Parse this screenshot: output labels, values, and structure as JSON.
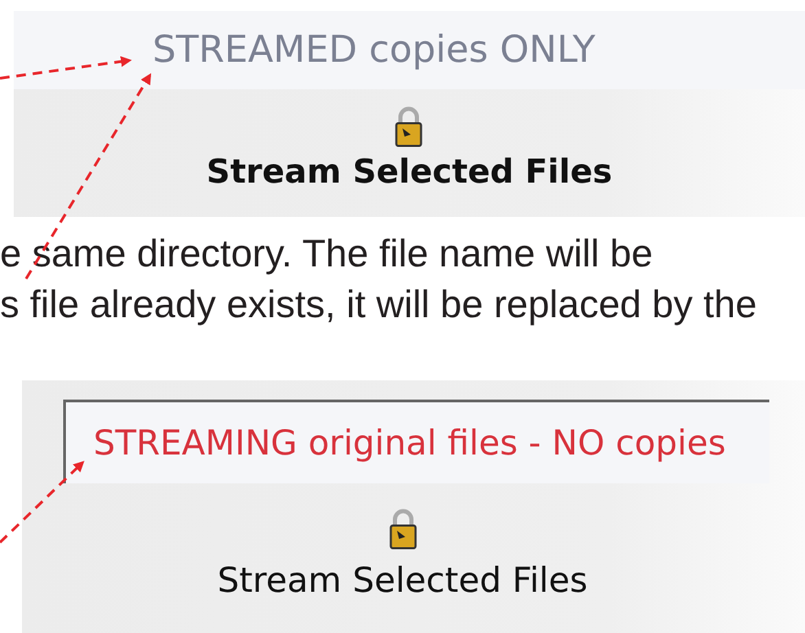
{
  "panels": [
    {
      "status": "STREAMED copies ONLY",
      "kind": "copies",
      "button": "Stream Selected Files"
    },
    {
      "status": "STREAMING original files - NO copies",
      "kind": "original",
      "button": "Stream Selected Files"
    }
  ],
  "paragraph": [
    "e same directory. The file name will be",
    "s file already exists, it will be replaced by the"
  ]
}
